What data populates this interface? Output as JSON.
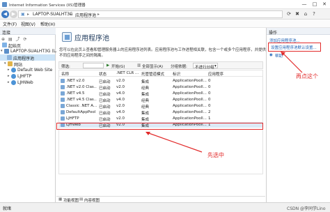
{
  "window": {
    "title": "Internet Information Services (IIS)管理器",
    "controls": [
      "—",
      "□",
      "✕"
    ]
  },
  "address": {
    "segments": [
      "LAPTOP-SUALHT3G",
      "应用程序池"
    ]
  },
  "menu": [
    "文件(F)",
    "视图(V)",
    "帮助(H)"
  ],
  "connections": {
    "header": "连接",
    "tree": [
      {
        "label": "起始页"
      },
      {
        "label": "LAPTOP-SUALHT3G (LA"
      },
      {
        "label": "应用程序池"
      },
      {
        "label": "网站"
      },
      {
        "label": "Default Web Site"
      },
      {
        "label": "LJHFTP"
      },
      {
        "label": "LJHWeb"
      }
    ]
  },
  "main": {
    "title": "应用程序池",
    "description": [
      "您可以在此页上查看和管理服务器上的应用程序池列表。应用程序池与工作进程相关联，包含一个或多个应用程序，并提供",
      "不同应用程序之间的隔离。"
    ],
    "filter": {
      "label": "筛选:",
      "go": "开始(G)",
      "show_all": "全部显示(A)",
      "group_by_label": "分组依据:",
      "group_by_value": "不进行分组"
    },
    "columns": [
      "名称",
      "状态",
      ".NET CLR ...",
      "托管管道模式",
      "标识",
      "应用程序"
    ],
    "rows": [
      [
        ".NET v2.0",
        "已启动",
        "v2.0",
        "集成",
        "ApplicationPooll...",
        "0"
      ],
      [
        ".NET v2.0 Clas...",
        "已启动",
        "v2.0",
        "经典",
        "ApplicationPooll...",
        "0"
      ],
      [
        ".NET v4.5",
        "已启动",
        "v4.0",
        "集成",
        "ApplicationPooll...",
        "0"
      ],
      [
        ".NET v4.5 Clas...",
        "已启动",
        "v4.0",
        "经典",
        "ApplicationPooll...",
        "0"
      ],
      [
        "Classic .NET A...",
        "已启动",
        "v2.0",
        "经典",
        "ApplicationPooll...",
        "0"
      ],
      [
        "DefaultAppPool",
        "已启动",
        "v4.0",
        "集成",
        "ApplicationPooll...",
        "2"
      ],
      [
        "LJHFTP",
        "已启动",
        "v2.0",
        "集成",
        "ApplicationPooll...",
        "1"
      ],
      [
        "LJHWeb",
        "已启动",
        "v2.0",
        "集成",
        "ApplicationPooll...",
        "1"
      ]
    ],
    "annotation": "先选中",
    "bottom_tabs": [
      "功能视图",
      "内容视图"
    ]
  },
  "actions": {
    "header": "操作",
    "items": [
      "添加应用程序池...",
      "设置应用程序池默认设置...",
      "帮助"
    ],
    "annotation": "再点这个"
  },
  "status": {
    "left": "就绪",
    "watermark": "CSDN @李同学Lino"
  },
  "colors": {
    "accent": "#1a5fb4",
    "annotation": "#e22b2b",
    "selection": "#cce4f7"
  }
}
